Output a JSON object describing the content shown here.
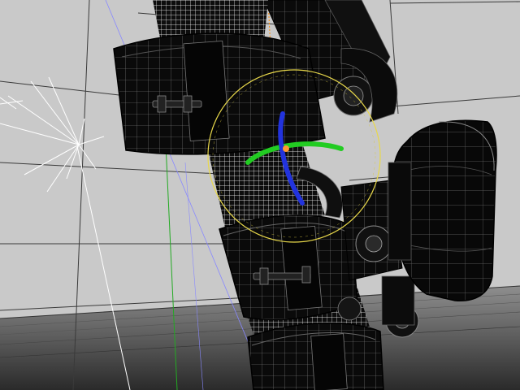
{
  "viewport": {
    "name": "3d-viewport",
    "view": "perspective",
    "display_mode": "wireframe-on-shaded",
    "background_color": "#c9c9c9",
    "floor_color": "#9a9a9a",
    "grid_color": "#3a3a3a",
    "mesh_color": "#0d0d0d",
    "wire_color": "#ffffff",
    "selection_color": "#ffd700",
    "light_color": "#ffffff"
  },
  "gizmo": {
    "type": "rotate",
    "x_axis_color": "#22cc22",
    "y_axis_color": "#2233dd",
    "screen_ring_color": "#e8d84a",
    "center_color": "#ff9933"
  },
  "guides": {
    "z_axis_color": "#22aa22",
    "helper_line_color": "#8888ff",
    "orange_guide_color": "#ff8800"
  },
  "objects": [
    {
      "name": "robot-arm-mesh",
      "selected": true
    },
    {
      "name": "side-pod-mesh",
      "selected": false
    },
    {
      "name": "spot-light",
      "selected": false
    }
  ]
}
